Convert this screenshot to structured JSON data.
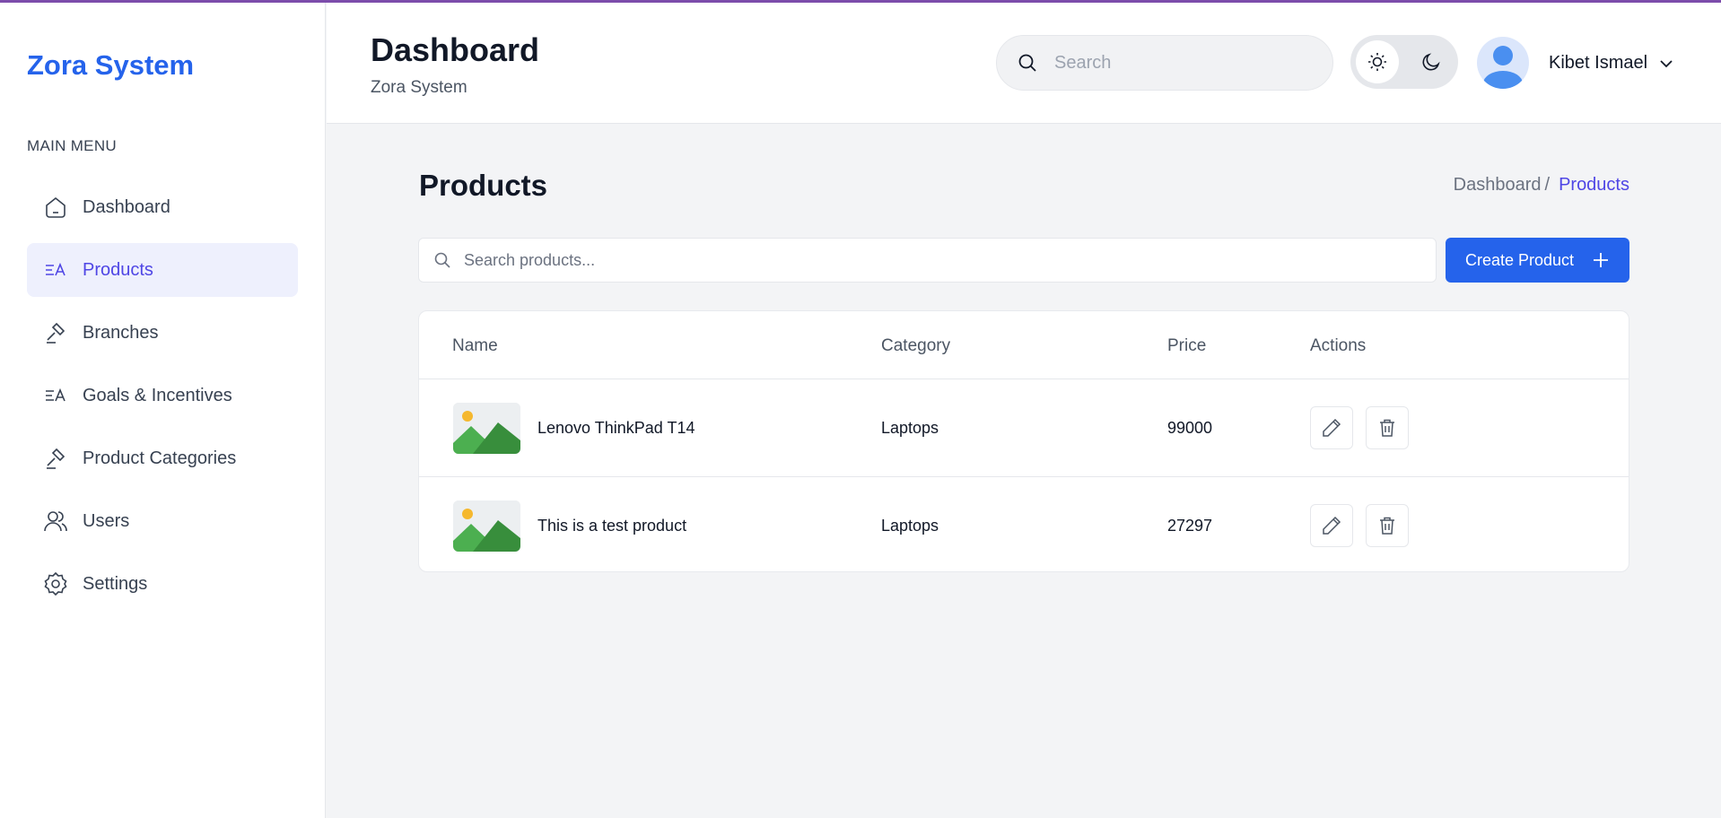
{
  "brand": "Zora System",
  "sidebar": {
    "menu_title": "MAIN MENU",
    "items": [
      {
        "label": "Dashboard",
        "icon": "home-icon"
      },
      {
        "label": "Products",
        "icon": "text-translate-icon",
        "active": true
      },
      {
        "label": "Branches",
        "icon": "gavel-icon"
      },
      {
        "label": "Goals & Incentives",
        "icon": "text-translate-icon"
      },
      {
        "label": "Product Categories",
        "icon": "gavel-icon"
      },
      {
        "label": "Users",
        "icon": "users-icon"
      },
      {
        "label": "Settings",
        "icon": "settings-icon"
      }
    ]
  },
  "header": {
    "title": "Dashboard",
    "subtitle": "Zora System",
    "search_placeholder": "Search",
    "user_name": "Kibet Ismael"
  },
  "page": {
    "title": "Products",
    "breadcrumb": {
      "parent": "Dashboard",
      "separator": "/",
      "current": "Products"
    },
    "search_placeholder": "Search products...",
    "create_label": "Create Product"
  },
  "table": {
    "columns": [
      "Name",
      "Category",
      "Price",
      "Actions"
    ],
    "rows": [
      {
        "name": "Lenovo ThinkPad T14",
        "category": "Laptops",
        "price": "99000"
      },
      {
        "name": "This is a test product",
        "category": "Laptops",
        "price": "27297"
      }
    ]
  },
  "colors": {
    "accent": "#2563eb",
    "active_text": "#4f46e5",
    "active_bg": "#eef0fd",
    "top_line": "#7c4dab"
  }
}
